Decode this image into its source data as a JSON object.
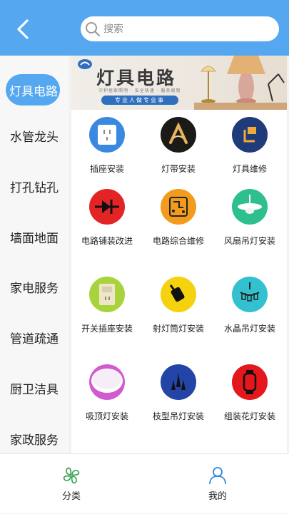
{
  "header": {
    "back_icon": "chevron-left-icon",
    "search": {
      "placeholder": "搜索",
      "value": ""
    }
  },
  "sidebar": {
    "active_index": 0,
    "items": [
      {
        "label": "灯具电路"
      },
      {
        "label": "水管龙头"
      },
      {
        "label": "打孔钻孔"
      },
      {
        "label": "墙面地面"
      },
      {
        "label": "家电服务"
      },
      {
        "label": "管道疏通"
      },
      {
        "label": "厨卫洁具"
      },
      {
        "label": "家政服务"
      }
    ]
  },
  "banner": {
    "title": "灯具电路",
    "small_text": "守护居家照明 · 安全快速 · 服务周到",
    "tagline": "专业人做专业事"
  },
  "services": [
    {
      "label": "插座安装",
      "icon": "socket-icon",
      "color": "#3a89e0"
    },
    {
      "label": "灯带安装",
      "icon": "light-strip-icon",
      "color": "#1b1a17"
    },
    {
      "label": "灯具维修",
      "icon": "lamp-icon",
      "color": "#1f3b7a"
    },
    {
      "label": "电路铺装改进",
      "icon": "diode-icon",
      "color": "#e32425"
    },
    {
      "label": "电路综合维修",
      "icon": "circuit-board-icon",
      "color": "#f29b1c"
    },
    {
      "label": "风扇吊灯安装",
      "icon": "ceiling-fan-icon",
      "color": "#2ebf8e"
    },
    {
      "label": "开关插座安装",
      "icon": "switch-socket-icon",
      "color": "#a7d33c"
    },
    {
      "label": "射灯筒灯安装",
      "icon": "spotlight-icon",
      "color": "#f5d20e"
    },
    {
      "label": "水晶吊灯安装",
      "icon": "chandelier-icon",
      "color": "#33c1cf"
    },
    {
      "label": "吸顶灯安装",
      "icon": "ceiling-light-icon",
      "color": "#d25bd0"
    },
    {
      "label": "枝型吊灯安装",
      "icon": "branch-pendant-icon",
      "color": "#2445a8"
    },
    {
      "label": "组装花灯安装",
      "icon": "lantern-icon",
      "color": "#e3171c"
    }
  ],
  "tabbar": {
    "items": [
      {
        "label": "分类",
        "icon": "clover-icon",
        "color": "#2f9e45"
      },
      {
        "label": "我的",
        "icon": "user-icon",
        "color": "#2b8ad9"
      }
    ]
  },
  "colors": {
    "accent": "#55a8ef",
    "background": "#f2f2f2"
  }
}
